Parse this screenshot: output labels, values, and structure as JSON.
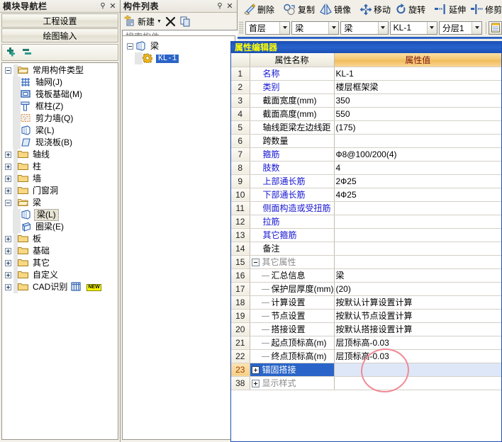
{
  "nav_panel": {
    "title": "模块导航栏",
    "pin_icon": "pin-icon",
    "close_icon": "close-icon",
    "buttons": [
      {
        "label": "工程设置"
      },
      {
        "label": "绘图输入"
      }
    ],
    "mini_toolbar": {
      "add_icon": "add-plus-icon",
      "remove_icon": "remove-minus-icon"
    },
    "tree": [
      {
        "label": "常用构件类型",
        "level": 0,
        "expander": "minus",
        "icon": "folder-open-icon"
      },
      {
        "label": "轴网(J)",
        "level": 1,
        "expander": "none",
        "icon": "axis-grid-icon"
      },
      {
        "label": "筏板基础(M)",
        "level": 1,
        "expander": "none",
        "icon": "raft-foundation-icon"
      },
      {
        "label": "框柱(Z)",
        "level": 1,
        "expander": "none",
        "icon": "frame-column-icon"
      },
      {
        "label": "剪力墙(Q)",
        "level": 1,
        "expander": "none",
        "icon": "shear-wall-icon"
      },
      {
        "label": "梁(L)",
        "level": 1,
        "expander": "none",
        "icon": "beam-icon"
      },
      {
        "label": "现浇板(B)",
        "level": 1,
        "expander": "none",
        "icon": "cast-slab-icon"
      },
      {
        "label": "轴线",
        "level": 0,
        "expander": "plus",
        "icon": "folder-icon"
      },
      {
        "label": "柱",
        "level": 0,
        "expander": "plus",
        "icon": "folder-icon"
      },
      {
        "label": "墙",
        "level": 0,
        "expander": "plus",
        "icon": "folder-icon"
      },
      {
        "label": "门窗洞",
        "level": 0,
        "expander": "plus",
        "icon": "folder-icon"
      },
      {
        "label": "梁",
        "level": 0,
        "expander": "minus",
        "icon": "folder-open-icon"
      },
      {
        "label": "梁(L)",
        "level": 1,
        "expander": "none",
        "icon": "beam-icon",
        "selected": true
      },
      {
        "label": "圈梁(E)",
        "level": 1,
        "expander": "none",
        "icon": "ring-beam-icon"
      },
      {
        "label": "板",
        "level": 0,
        "expander": "plus",
        "icon": "folder-icon"
      },
      {
        "label": "基础",
        "level": 0,
        "expander": "plus",
        "icon": "folder-icon"
      },
      {
        "label": "其它",
        "level": 0,
        "expander": "plus",
        "icon": "folder-icon"
      },
      {
        "label": "自定义",
        "level": 0,
        "expander": "plus",
        "icon": "folder-icon"
      },
      {
        "label": "CAD识别",
        "level": 0,
        "expander": "plus",
        "icon": "folder-icon",
        "extra_icon": "cad-icon",
        "badge": "NEW"
      }
    ]
  },
  "component_panel": {
    "title": "构件列表",
    "pin_icon": "pin-icon",
    "close_icon": "close-icon",
    "toolbar": {
      "new_label": "新建",
      "new_icon": "new-item-icon",
      "delete_icon": "delete-x-icon",
      "copy_icon": "copy-icon"
    },
    "search": {
      "placeholder": "搜索构件...",
      "value": "",
      "search_icon": "magnifier-icon"
    },
    "tree": [
      {
        "label": "梁",
        "level": 0,
        "expander": "minus",
        "icon": "beam-icon"
      },
      {
        "label": "KL-1",
        "level": 1,
        "expander": "none",
        "icon": "gear-icon",
        "selected": true
      }
    ]
  },
  "toolbar": {
    "actions": [
      {
        "label": "删除",
        "icon": "delete-eraser-icon"
      },
      {
        "label": "复制",
        "icon": "copy-circles-icon"
      },
      {
        "label": "镜像",
        "icon": "mirror-icon"
      },
      {
        "label": "移动",
        "icon": "move-arrows-icon"
      },
      {
        "label": "旋转",
        "icon": "rotate-icon"
      },
      {
        "label": "延伸",
        "icon": "extend-icon"
      },
      {
        "label": "修剪",
        "icon": "trim-icon"
      }
    ],
    "selectors": [
      {
        "name": "floor",
        "value": "首层"
      },
      {
        "name": "category",
        "value": "梁"
      },
      {
        "name": "component-type",
        "value": "梁"
      },
      {
        "name": "component-name",
        "value": "KL-1"
      },
      {
        "name": "layer",
        "value": "分层1"
      }
    ],
    "extra_button_icon": "properties-icon"
  },
  "property_editor": {
    "title": "属性编辑器",
    "columns": {
      "index": "",
      "name": "属性名称",
      "value": "属性值"
    },
    "rows": [
      {
        "num": "1",
        "name": "名称",
        "value": "KL-1",
        "style": "blue"
      },
      {
        "num": "2",
        "name": "类别",
        "value": "楼层框架梁",
        "style": "blue"
      },
      {
        "num": "3",
        "name": "截面宽度(mm)",
        "value": "350",
        "style": "black"
      },
      {
        "num": "4",
        "name": "截面高度(mm)",
        "value": "550",
        "style": "black"
      },
      {
        "num": "5",
        "name": "轴线距梁左边线距",
        "value": "(175)",
        "style": "black"
      },
      {
        "num": "6",
        "name": "跨数量",
        "value": "",
        "style": "black"
      },
      {
        "num": "7",
        "name": "箍筋",
        "value": "Ф8@100/200(4)",
        "style": "blue"
      },
      {
        "num": "8",
        "name": "肢数",
        "value": "4",
        "style": "blue"
      },
      {
        "num": "9",
        "name": "上部通长筋",
        "value": "2Ф25",
        "style": "blue"
      },
      {
        "num": "10",
        "name": "下部通长筋",
        "value": "4Ф25",
        "style": "blue"
      },
      {
        "num": "11",
        "name": "侧面构造或受扭筋",
        "value": "",
        "style": "blue"
      },
      {
        "num": "12",
        "name": "拉筋",
        "value": "",
        "style": "blue"
      },
      {
        "num": "13",
        "name": "其它箍筋",
        "value": "",
        "style": "blue"
      },
      {
        "num": "14",
        "name": "备注",
        "value": "",
        "style": "black"
      },
      {
        "num": "15",
        "name": "其它属性",
        "value": "",
        "style": "gray",
        "group": "expanded"
      },
      {
        "num": "16",
        "name": "汇总信息",
        "value": "梁",
        "style": "black",
        "child": true
      },
      {
        "num": "17",
        "name": "保护层厚度(mm)",
        "value": "(20)",
        "style": "black",
        "child": true
      },
      {
        "num": "18",
        "name": "计算设置",
        "value": "按默认计算设置计算",
        "style": "black",
        "child": true
      },
      {
        "num": "19",
        "name": "节点设置",
        "value": "按默认节点设置计算",
        "style": "black",
        "child": true
      },
      {
        "num": "20",
        "name": "搭接设置",
        "value": "按默认搭接设置计算",
        "style": "black",
        "child": true
      },
      {
        "num": "21",
        "name": "起点顶标高(m)",
        "value": "层顶标高-0.03",
        "style": "black",
        "child": true
      },
      {
        "num": "22",
        "name": "终点顶标高(m)",
        "value": "层顶标高-0.03",
        "style": "black",
        "child": true,
        "child_last": false
      },
      {
        "num": "23",
        "name": "锚固搭接",
        "value": "",
        "style": "black",
        "group": "collapsed",
        "selected": true
      },
      {
        "num": "38",
        "name": "显示样式",
        "value": "",
        "style": "gray",
        "group": "collapsed"
      }
    ]
  },
  "annotation": {
    "shape": "red-ellipse-highlight"
  },
  "colors": {
    "title_bar_blue": "#1b4fb5",
    "title_text_yellow": "#ffff00",
    "value_header_orange": "#f6c873",
    "value_header_text": "#7b1414",
    "selection_blue": "#2a64c8",
    "property_name_blue": "#1414d2",
    "annotation_red": "#f08a96"
  }
}
